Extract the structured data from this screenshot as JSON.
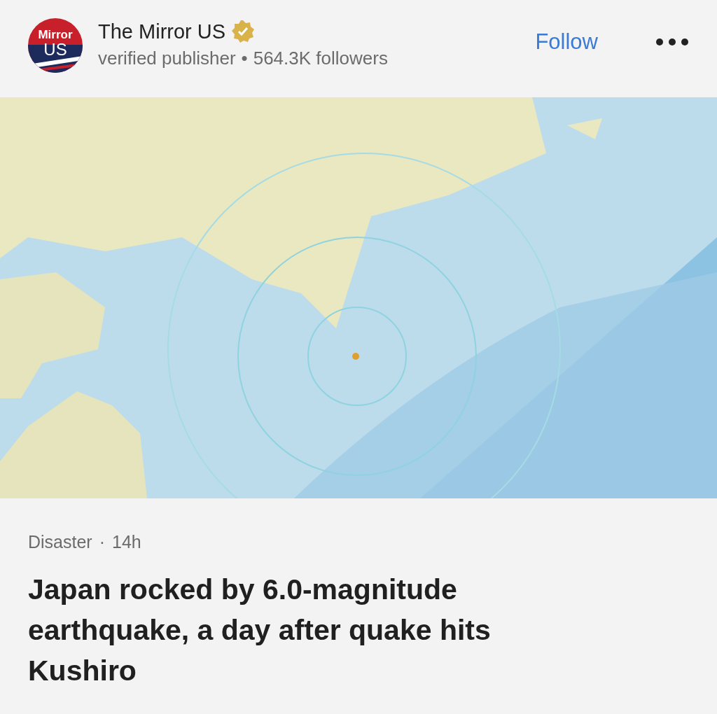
{
  "publisher": {
    "logo": {
      "line_1": "Mirror",
      "line_2": "US"
    },
    "name": "The Mirror US",
    "verified": true,
    "subtitle": "verified publisher",
    "separator": "•",
    "followers": "564.3K followers",
    "follow": "Follow"
  },
  "article": {
    "category": "Disaster",
    "separator": "·",
    "age": "14h",
    "headline": "Japan rocked by 6.0-magnitude earthquake, a day after quake hits Kushiro"
  }
}
